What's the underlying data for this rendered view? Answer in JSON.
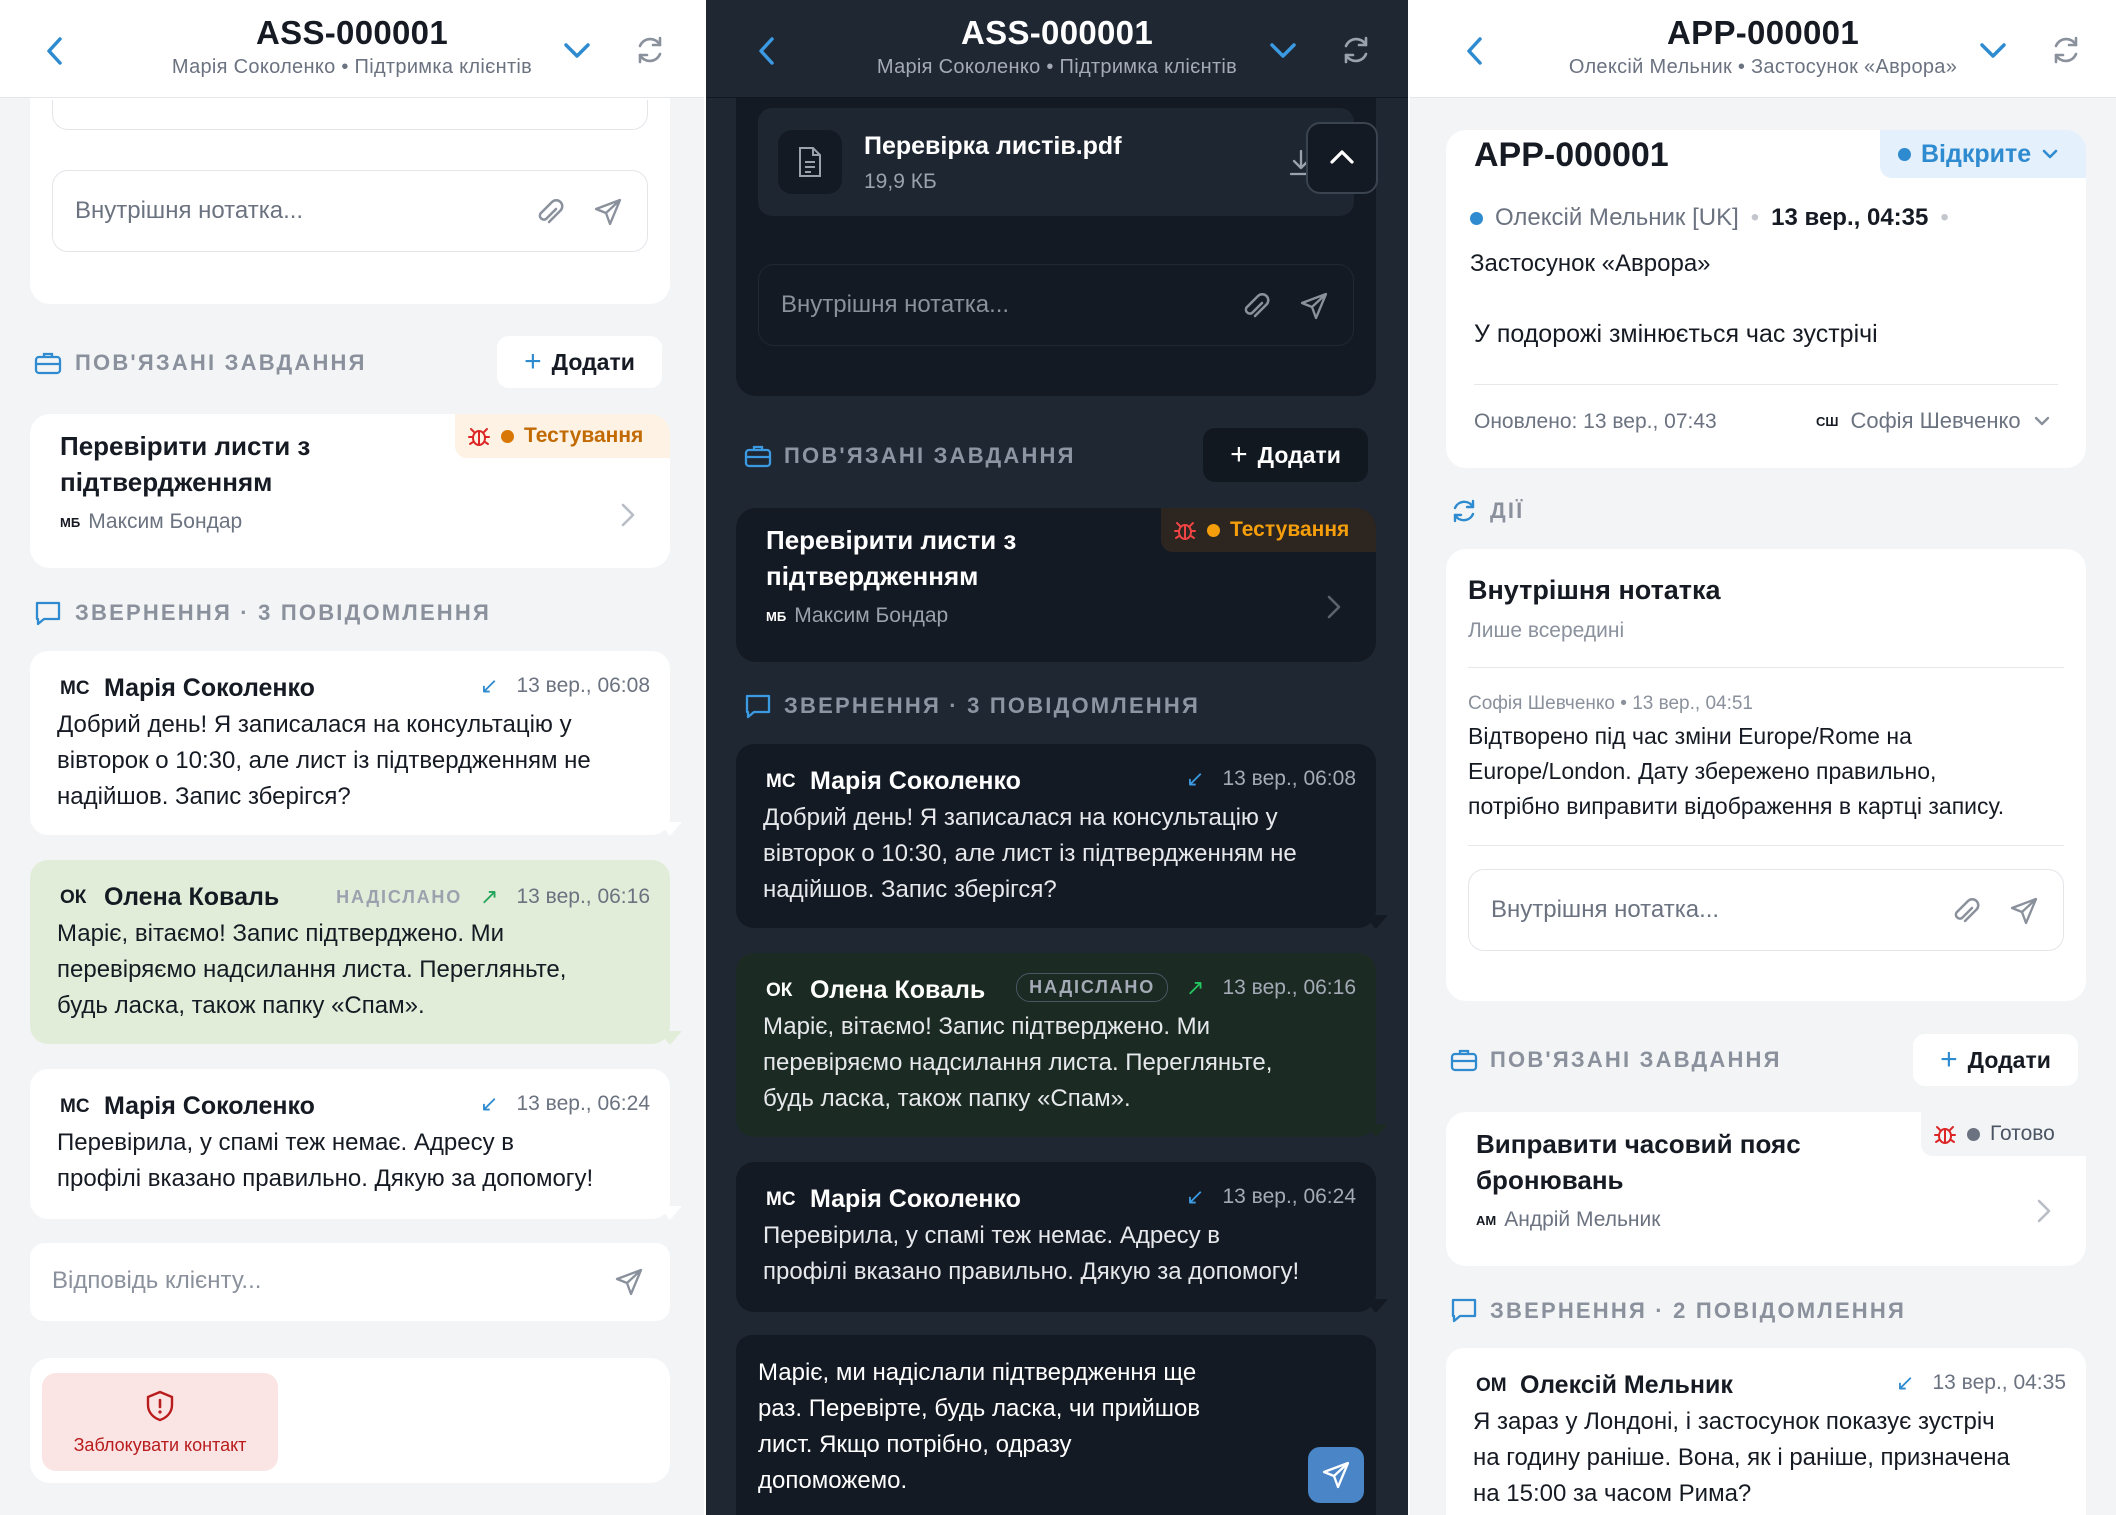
{
  "colors": {
    "accent": "#2f8bd0",
    "testing": "#d97706",
    "bug": "#dc2626",
    "sent_bubble": "#e2edd9",
    "block": "#b91c1c",
    "done": "#6b7280"
  },
  "p1": {
    "header": {
      "title": "ASS-000001",
      "subtitle": "Марія Соколенко • Підтримка клієнтів"
    },
    "note_placeholder": "Внутрішня нотатка...",
    "related": {
      "label": "ПОВ'ЯЗАНІ ЗАВДАННЯ",
      "add": "Додати"
    },
    "task": {
      "title_l1": "Перевірити листи з",
      "title_l2": "підтвердженням",
      "status": "Тестування",
      "assignee_initials": "МБ",
      "assignee": "Максим Бондар"
    },
    "thread_label": "ЗВЕРНЕННЯ · 3 ПОВІДОМЛЕННЯ",
    "messages": [
      {
        "initials": "МС",
        "name": "Марія Соколенко",
        "time": "13 вер., 06:08",
        "l1": "Добрий день! Я записалася на консультацію у",
        "l2": "вівторок о 10:30, але лист із підтвердженням не",
        "l3": "надійшов. Запис зберігся?"
      },
      {
        "initials": "ОК",
        "name": "Олена Коваль",
        "sent": "НАДІСЛАНО",
        "time": "13 вер., 06:16",
        "l1": "Маріє, вітаємо! Запис підтверджено. Ми",
        "l2": "перевіряємо надсилання листа. Перегляньте,",
        "l3": "будь ласка, також папку «Спам»."
      },
      {
        "initials": "МС",
        "name": "Марія Соколенко",
        "time": "13 вер., 06:24",
        "l1": "Перевірила, у спамі теж немає. Адресу в",
        "l2": "профілі вказано правильно. Дякую за допомогу!"
      }
    ],
    "reply_placeholder": "Відповідь клієнту...",
    "block_label": "Заблокувати контакт"
  },
  "p2": {
    "header": {
      "title": "ASS-000001",
      "subtitle": "Марія Соколенко • Підтримка клієнтів"
    },
    "file": {
      "name": "Перевірка листів.pdf",
      "size": "19,9 КБ"
    },
    "note_placeholder": "Внутрішня нотатка...",
    "related": {
      "label": "ПОВ'ЯЗАНІ ЗАВДАННЯ",
      "add": "Додати"
    },
    "task": {
      "title_l1": "Перевірити листи з",
      "title_l2": "підтвердженням",
      "status": "Тестування",
      "assignee_initials": "МБ",
      "assignee": "Максим Бондар"
    },
    "thread_label": "ЗВЕРНЕННЯ · 3 ПОВІДОМЛЕННЯ",
    "messages": [
      {
        "initials": "МС",
        "name": "Марія Соколенко",
        "time": "13 вер., 06:08",
        "l1": "Добрий день! Я записалася на консультацію у",
        "l2": "вівторок о 10:30, але лист із підтвердженням не",
        "l3": "надійшов. Запис зберігся?"
      },
      {
        "initials": "ОК",
        "name": "Олена Коваль",
        "sent": "НАДІСЛАНО",
        "time": "13 вер., 06:16",
        "l1": "Маріє, вітаємо! Запис підтверджено. Ми",
        "l2": "перевіряємо надсилання листа. Перегляньте,",
        "l3": "будь ласка, також папку «Спам»."
      },
      {
        "initials": "МС",
        "name": "Марія Соколенко",
        "time": "13 вер., 06:24",
        "l1": "Перевірила, у спамі теж немає. Адресу в",
        "l2": "профілі вказано правильно. Дякую за допомогу!"
      }
    ],
    "reply": {
      "l1": "Маріє, ми надіслали підтвердження ще",
      "l2": "раз. Перевірте, будь ласка, чи прийшов",
      "l3": "лист. Якщо потрібно, одразу",
      "l4": "допоможемо."
    }
  },
  "p3": {
    "header": {
      "title": "APP-000001",
      "subtitle": "Олексій Мельник • Застосунок «Аврора»"
    },
    "ticket": {
      "id": "APP-000001",
      "status": "Відкрите",
      "author": "Олексій Мельник [UK]",
      "date": "13 вер., 04:35",
      "app": "Застосунок «Аврора»",
      "subject": "У подорожі змінюється час зустрічі",
      "updated": "Оновлено: 13 вер., 07:43",
      "assignee_initials": "СШ",
      "assignee": "Софія Шевченко"
    },
    "actions_label": "ДІЇ",
    "note": {
      "title": "Внутрішня нотатка",
      "subtitle": "Лише всередині",
      "meta": "Софія Шевченко • 13 вер., 04:51",
      "l1": "Відтворено під час зміни Europe/Rome на",
      "l2": "Europe/London. Дату збережено правильно,",
      "l3": "потрібно виправити відображення в картці запису.",
      "placeholder": "Внутрішня нотатка..."
    },
    "related": {
      "label": "ПОВ'ЯЗАНІ ЗАВДАННЯ",
      "add": "Додати"
    },
    "task": {
      "title_l1": "Виправити часовий пояс",
      "title_l2": "бронювань",
      "status": "Готово",
      "assignee_initials": "АМ",
      "assignee": "Андрій Мельник"
    },
    "thread_label": "ЗВЕРНЕННЯ · 2 ПОВІДОМЛЕННЯ",
    "message": {
      "initials": "ОМ",
      "name": "Олексій Мельник",
      "time": "13 вер., 04:35",
      "l1": "Я зараз у Лондоні, і застосунок показує зустріч",
      "l2": "на годину раніше. Вона, як і раніше, призначена",
      "l3": "на 15:00 за часом Рима?"
    }
  }
}
